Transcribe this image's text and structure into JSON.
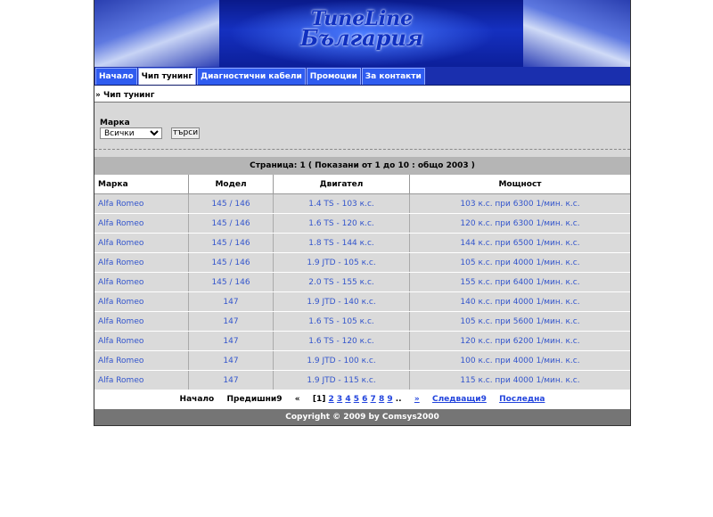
{
  "header": {
    "logo_line1": "TuneLine",
    "logo_line2": "България"
  },
  "nav": {
    "tabs": [
      {
        "label": "Начало",
        "active": false
      },
      {
        "label": "Чип тунинг",
        "active": true
      },
      {
        "label": "Диагностични кабели",
        "active": false
      },
      {
        "label": "Промоции",
        "active": false
      },
      {
        "label": "За контакти",
        "active": false
      }
    ]
  },
  "breadcrumb": "» Чип тунинг",
  "search": {
    "label": "Марка",
    "selected": "Всички",
    "button": "търси"
  },
  "page_info": "Страница: 1 ( Показани от 1 до 10 : общо 2003 )",
  "table": {
    "headers": [
      "Марка",
      "Модел",
      "Двигател",
      "Мощност"
    ],
    "rows": [
      [
        "Alfa Romeo",
        "145 / 146",
        "1.4 TS - 103 к.с.",
        "103 к.с. при 6300 1/мин. к.с."
      ],
      [
        "Alfa Romeo",
        "145 / 146",
        "1.6 TS - 120 к.с.",
        "120 к.с. при 6300 1/мин. к.с."
      ],
      [
        "Alfa Romeo",
        "145 / 146",
        "1.8 TS - 144 к.с.",
        "144 к.с. при 6500 1/мин. к.с."
      ],
      [
        "Alfa Romeo",
        "145 / 146",
        "1.9 JTD - 105 к.с.",
        "105 к.с. при 4000 1/мин. к.с."
      ],
      [
        "Alfa Romeo",
        "145 / 146",
        "2.0 TS - 155 к.с.",
        "155 к.с. при 6400 1/мин. к.с."
      ],
      [
        "Alfa Romeo",
        "147",
        "1.9 JTD - 140 к.с.",
        "140 к.с. при 4000 1/мин. к.с."
      ],
      [
        "Alfa Romeo",
        "147",
        "1.6 TS - 105 к.с.",
        "105 к.с. при 5600 1/мин. к.с."
      ],
      [
        "Alfa Romeo",
        "147",
        "1.6 TS - 120 к.с.",
        "120 к.с. при 6200 1/мин. к.с."
      ],
      [
        "Alfa Romeo",
        "147",
        "1.9 JTD - 100 к.с.",
        "100 к.с. при 4000 1/мин. к.с."
      ],
      [
        "Alfa Romeo",
        "147",
        "1.9 JTD - 115 к.с.",
        "115 к.с. при 4000 1/мин. к.с."
      ]
    ]
  },
  "pager": {
    "first": "Начало",
    "prev": "Предишни9",
    "back": "«",
    "current": "[1]",
    "pages": [
      "2",
      "3",
      "4",
      "5",
      "6",
      "7",
      "8",
      "9"
    ],
    "dots": "..",
    "forward": "»",
    "next": "Следващи9",
    "last": "Последна"
  },
  "footer": "Copyright © 2009 by Comsys2000",
  "colors": {
    "nav_bg": "#1a2fae",
    "tab_bg": "#2f5cf0",
    "link": "#3355cc",
    "footer_bg": "#757575"
  }
}
